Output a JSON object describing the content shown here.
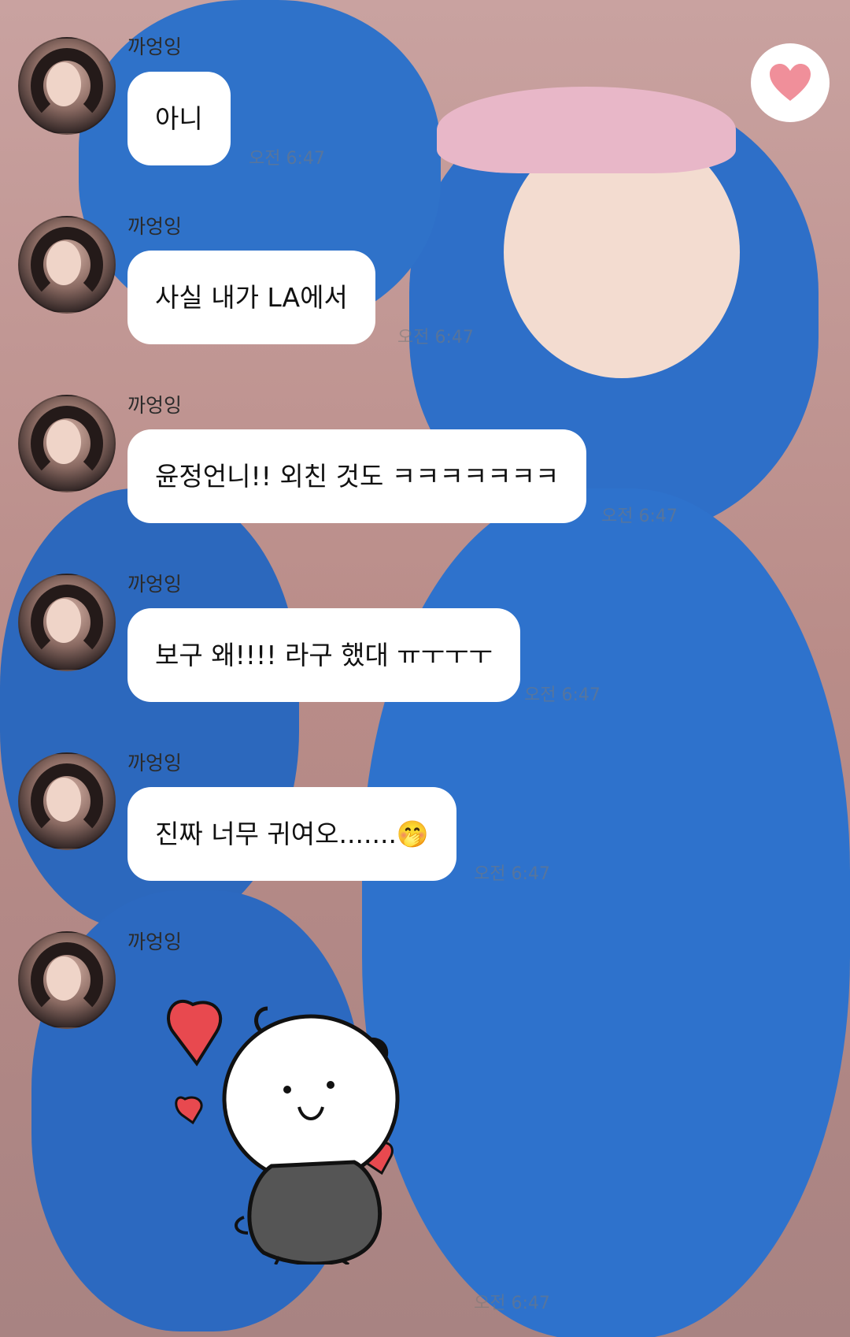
{
  "sticker": {
    "icon": "dog-with-hearts-sticker-icon"
  },
  "like_button": {
    "icon": "heart-icon",
    "color": "#f08f9a"
  },
  "messages": [
    {
      "sender": "까엉잉",
      "text": "아니",
      "time": "오전 6:47"
    },
    {
      "sender": "까엉잉",
      "text": "사실 내가 LA에서",
      "time": "오전 6:47"
    },
    {
      "sender": "까엉잉",
      "text": "윤정언니!! 외친 것도 ㅋㅋㅋㅋㅋㅋㅋ",
      "time": "오전 6:47"
    },
    {
      "sender": "까엉잉",
      "text": "보구 왜!!!! 라구 했대 ㅠㅜㅜㅜ",
      "time": "오전 6:47"
    },
    {
      "sender": "까엉잉",
      "text": "진짜 너무 귀여오.......🤭",
      "time": "오전 6:47"
    },
    {
      "sender": "까엉잉",
      "text": "",
      "time": "오전 6:47"
    }
  ]
}
